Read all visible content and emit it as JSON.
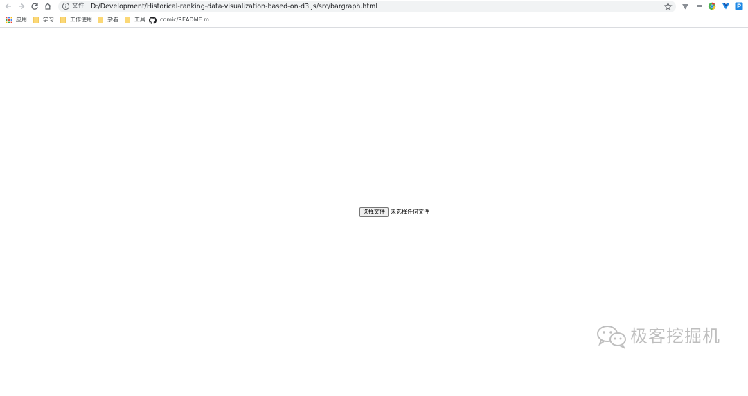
{
  "toolbar": {
    "omnibox": {
      "label": "文件",
      "url": "D:/Development/Historical-ranking-data-visualization-based-on-d3.js/src/bargraph.html"
    },
    "icons": [
      "back-icon",
      "forward-icon",
      "reload-icon",
      "home-icon",
      "info-icon",
      "star-icon"
    ],
    "extensions": [
      "vimium-extension-icon",
      "reader-extension-icon",
      "chrome-extension-icon",
      "vue-devtools-extension-icon",
      "p-extension-icon"
    ]
  },
  "bookmarks": {
    "apps_label": "应用",
    "items": [
      {
        "label": "学习",
        "icon": "folder-icon"
      },
      {
        "label": "工作使用",
        "icon": "folder-icon"
      },
      {
        "label": "杂看",
        "icon": "folder-icon"
      },
      {
        "label": "工具",
        "icon": "folder-icon"
      },
      {
        "label": "comic/README.m...",
        "icon": "github-icon"
      }
    ]
  },
  "page": {
    "file_button_label": "选择文件",
    "file_status": "未选择任何文件"
  },
  "watermark": {
    "text": "极客挖掘机"
  },
  "colors": {
    "omnibox_bg": "#f1f3f4",
    "folder": "#fbd876",
    "text": "#202124",
    "icon_gray": "#5f6368"
  }
}
